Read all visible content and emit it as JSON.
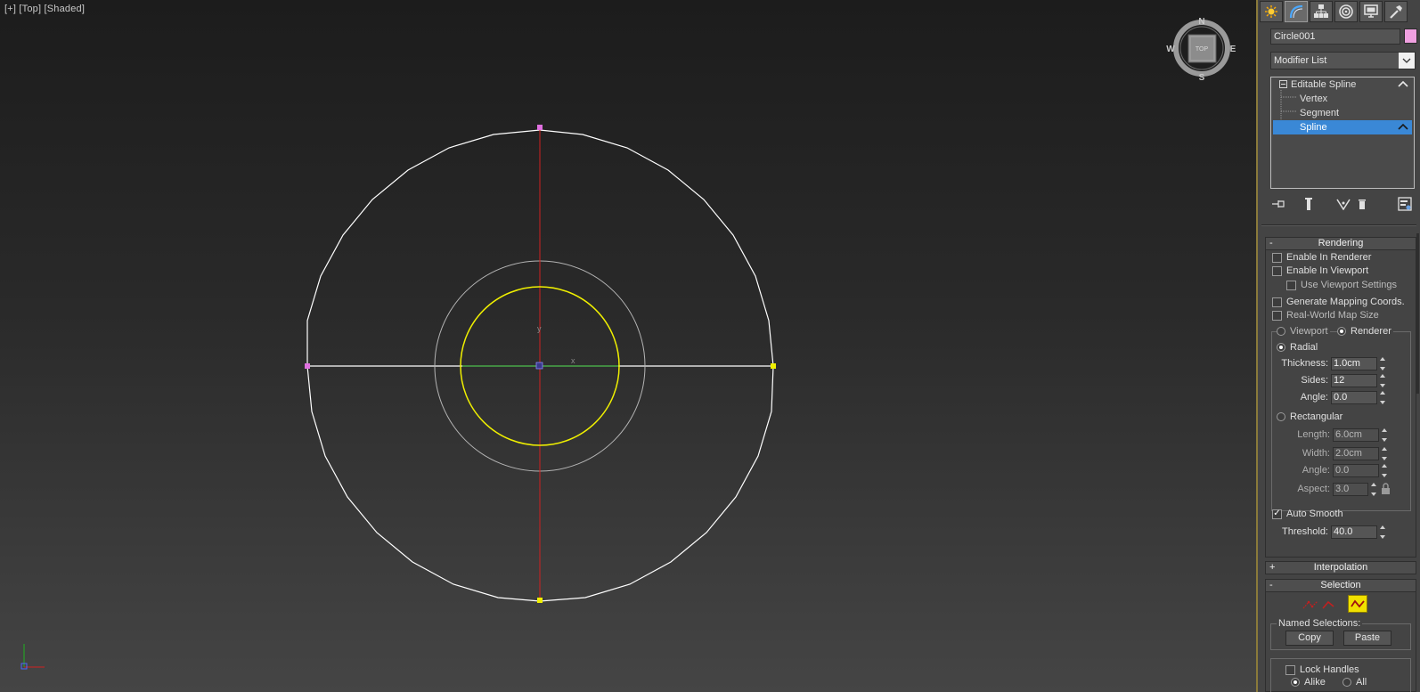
{
  "viewport": {
    "label": "[+] [Top] [Shaded]",
    "viewcube": {
      "face": "TOP",
      "north": "N",
      "south": "S",
      "east": "E",
      "west": "W"
    },
    "gizmo_labels": {
      "x": "x",
      "y": "y"
    }
  },
  "colors": {
    "spline_white": "#ffffff",
    "spline_selected_yellow": "#f0f000",
    "axis_red": "#d02020",
    "axis_green": "#20b020",
    "object_color": "#f0a0e0",
    "selection_highlight": "#3a88d6",
    "vertex_magenta": "#e070e0",
    "vertex_yellow": "#f0f000"
  },
  "command_panel": {
    "tabs": [
      {
        "name": "create-tab",
        "icon": "sun-icon"
      },
      {
        "name": "modify-tab",
        "icon": "curve-icon",
        "active": true
      },
      {
        "name": "hierarchy-tab",
        "icon": "hierarchy-icon"
      },
      {
        "name": "motion-tab",
        "icon": "motion-icon"
      },
      {
        "name": "display-tab",
        "icon": "monitor-icon"
      },
      {
        "name": "utilities-tab",
        "icon": "hammer-icon"
      }
    ],
    "object_name": "Circle001",
    "modifier_list": "Modifier List",
    "stack": {
      "root": "Editable Spline",
      "items": [
        "Vertex",
        "Segment",
        "Spline"
      ],
      "selected": "Spline"
    },
    "rendering": {
      "title": "Rendering",
      "collapse": "-",
      "enable_in_renderer": "Enable In Renderer",
      "enable_in_viewport": "Enable In Viewport",
      "use_viewport_settings": "Use Viewport Settings",
      "generate_mapping": "Generate Mapping Coords.",
      "real_world": "Real-World Map Size",
      "viewport": "Viewport",
      "renderer": "Renderer",
      "radial": "Radial",
      "thickness_label": "Thickness:",
      "thickness": "1.0cm",
      "sides_label": "Sides:",
      "sides": "12",
      "angle_label": "Angle:",
      "angle": "0.0",
      "rectangular": "Rectangular",
      "length_label": "Length:",
      "length": "6.0cm",
      "width_label": "Width:",
      "width": "2.0cm",
      "rect_angle_label": "Angle:",
      "rect_angle": "0.0",
      "aspect_label": "Aspect:",
      "aspect": "3.0",
      "auto_smooth": "Auto Smooth",
      "threshold_label": "Threshold:",
      "threshold": "40.0"
    },
    "interpolation": {
      "title": "Interpolation",
      "expand": "+"
    },
    "selection": {
      "title": "Selection",
      "collapse": "-",
      "named_selections": "Named Selections:",
      "copy": "Copy",
      "paste": "Paste",
      "lock_handles": "Lock Handles",
      "alike": "Alike",
      "all": "All"
    }
  }
}
